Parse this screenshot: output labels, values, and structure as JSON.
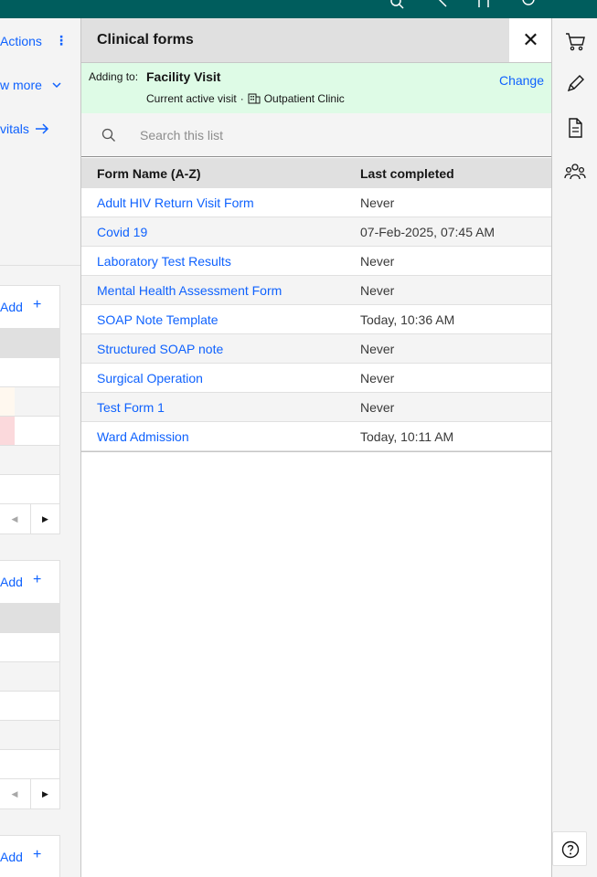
{
  "left": {
    "actions_label": "Actions",
    "show_more_label": "w more",
    "vitals_link": "vitals",
    "cards": [
      {
        "add_label": "Add",
        "plus": "+"
      },
      {
        "add_label": "Add",
        "plus": "+"
      },
      {
        "add_label": "Add",
        "plus": "+"
      }
    ]
  },
  "panel": {
    "title": "Clinical forms",
    "close": "✕",
    "visit": {
      "adding_to_label": "Adding to:",
      "name": "Facility Visit",
      "status": "Current active visit",
      "separator": "·",
      "location": "Outpatient Clinic",
      "change_label": "Change"
    },
    "search": {
      "placeholder": "Search this list"
    },
    "table": {
      "headers": [
        "Form Name (A-Z)",
        "Last completed"
      ],
      "rows": [
        {
          "name": "Adult HIV Return Visit Form",
          "last": "Never"
        },
        {
          "name": "Covid 19",
          "last": "07-Feb-2025, 07:45 AM"
        },
        {
          "name": "Laboratory Test Results",
          "last": "Never"
        },
        {
          "name": "Mental Health Assessment Form",
          "last": "Never"
        },
        {
          "name": "SOAP Note Template",
          "last": "Today, 10:36 AM"
        },
        {
          "name": "Structured SOAP note",
          "last": "Never"
        },
        {
          "name": "Surgical Operation",
          "last": "Never"
        },
        {
          "name": "Test Form 1",
          "last": "Never"
        },
        {
          "name": "Ward Admission",
          "last": "Today, 10:11 AM"
        }
      ]
    }
  },
  "rail": {
    "icons": [
      "cart-icon",
      "pen-icon",
      "document-icon",
      "group-icon"
    ],
    "help_icon": "help-icon"
  },
  "topbar": {
    "icons": [
      "search-icon",
      "pin-icon",
      "people-icon",
      "user-icon",
      "overflow-menu-icon"
    ],
    "overflow_glyph": "···"
  }
}
